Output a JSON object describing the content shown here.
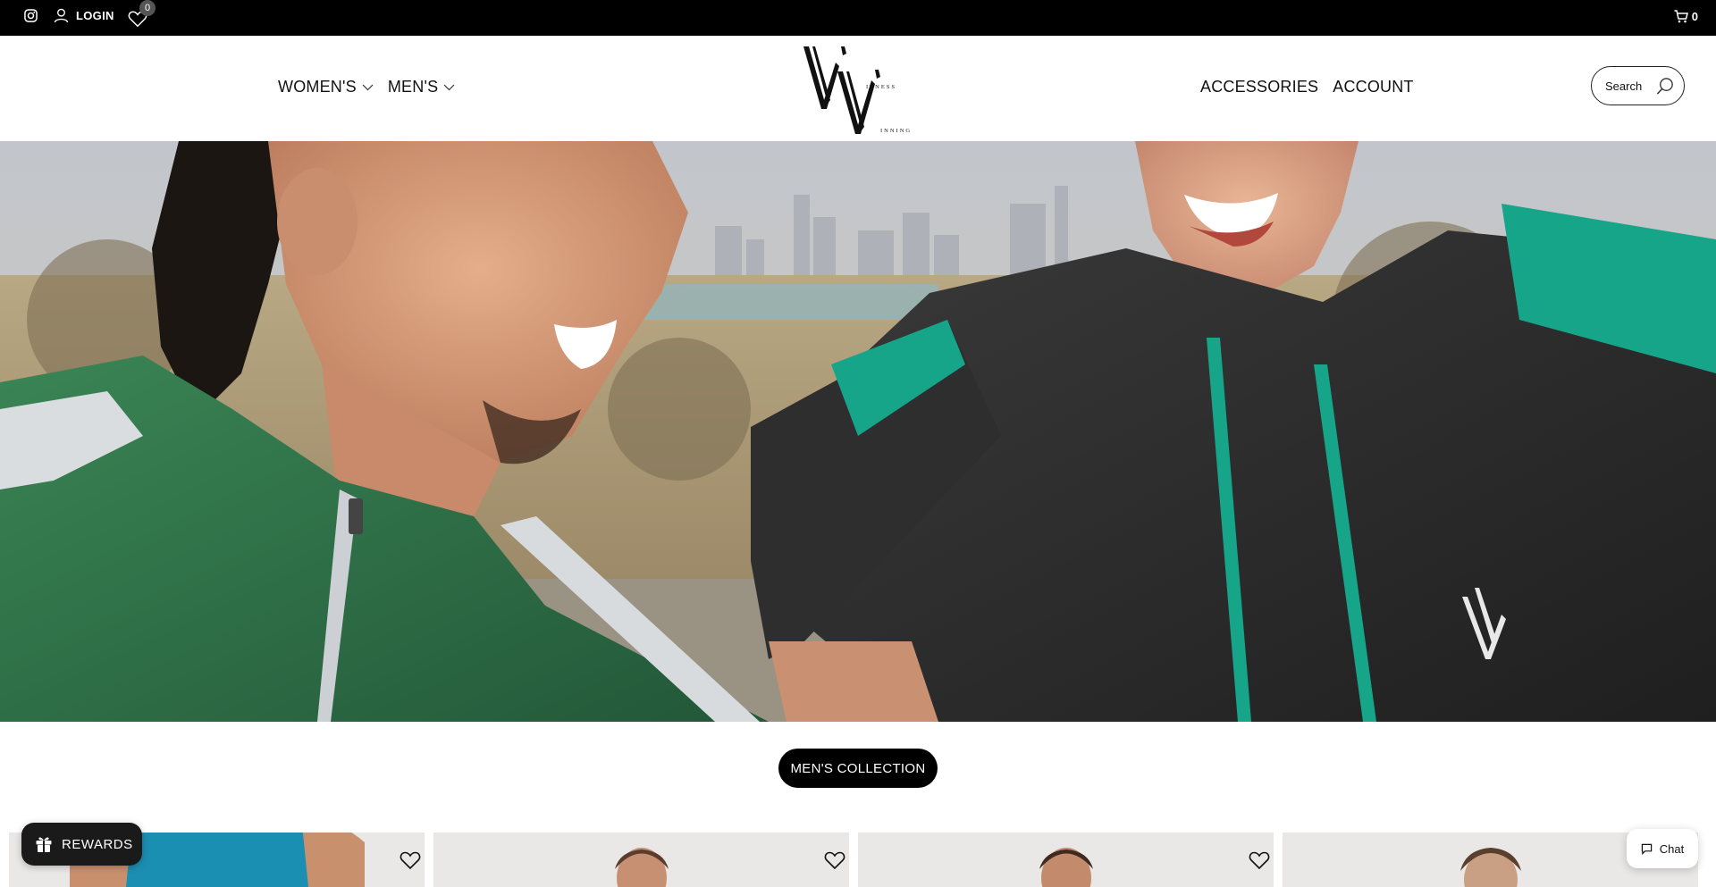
{
  "topbar": {
    "login_label": "LOGIN",
    "wishlist_count": "0",
    "cart_count": "0",
    "icons": [
      "instagram-icon",
      "user-icon",
      "heart-icon",
      "cart-icon"
    ]
  },
  "header": {
    "nav_left": [
      {
        "label": "WOMEN'S",
        "has_dropdown": true
      },
      {
        "label": "MEN'S",
        "has_dropdown": true
      }
    ],
    "nav_right": [
      {
        "label": "ACCESSORIES"
      },
      {
        "label": "ACCOUNT"
      }
    ],
    "logo": {
      "mark": "WW",
      "top_word": "ITNESS",
      "bottom_word": "INNING"
    },
    "search": {
      "placeholder": "Search"
    }
  },
  "hero": {
    "colors": {
      "sky": "#b9bdc2",
      "green_jacket": "#2e6e45",
      "black_jacket": "#2a2a2a",
      "teal_accent": "#17a589",
      "field": "#a89470"
    }
  },
  "collection": {
    "button_label": "MEN'S COLLECTION"
  },
  "products": [
    {
      "color": "#e9e8e6",
      "shirt": "#1b8fb1"
    },
    {
      "color": "#e6e5e3",
      "shirt": "#8a6a55"
    },
    {
      "color": "#e6e5e3",
      "shirt": "#6b4e3d"
    },
    {
      "color": "#ebeae8",
      "shirt": "#7a5a45"
    }
  ],
  "widgets": {
    "rewards_label": "REWARDS",
    "chat_label": "Chat"
  }
}
